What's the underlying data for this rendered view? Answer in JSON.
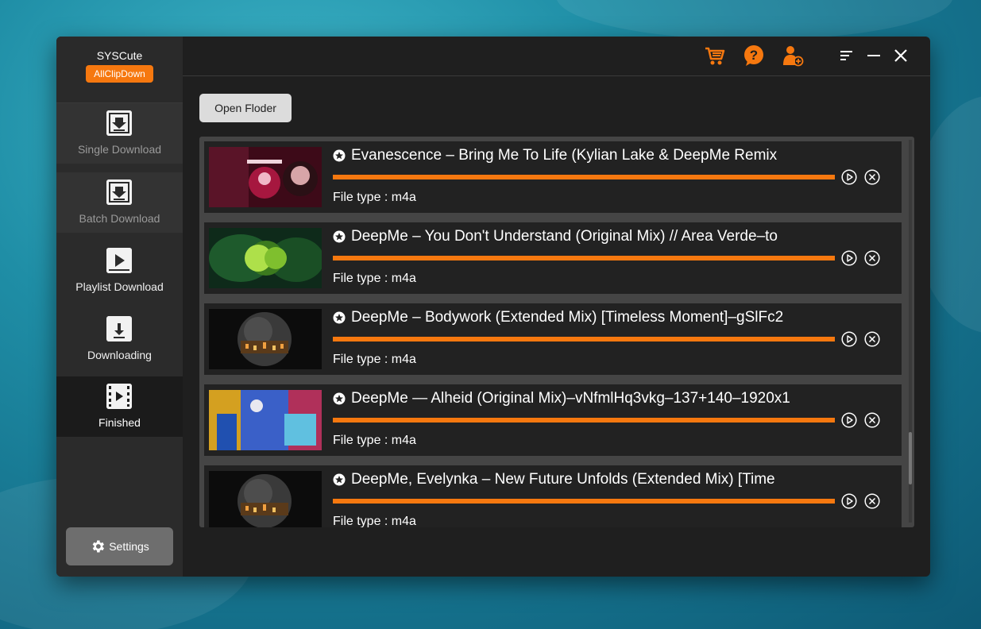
{
  "brand": {
    "name": "SYSCute",
    "badge": "AllClipDown"
  },
  "nav": [
    {
      "label": "Single Download",
      "icon": "download-box-icon"
    },
    {
      "label": "Batch Download",
      "icon": "download-box-icon"
    },
    {
      "label": "Playlist Download",
      "icon": "play-box-icon"
    },
    {
      "label": "Downloading",
      "icon": "file-download-icon"
    },
    {
      "label": "Finished",
      "icon": "film-icon"
    }
  ],
  "settings": {
    "label": "Settings"
  },
  "toolbar": {
    "open_folder": "Open Floder"
  },
  "colors": {
    "accent": "#f6780f",
    "window_bg": "#1f1f1f",
    "sidebar_bg": "#2b2b2b",
    "row_bg": "#222222"
  },
  "items": [
    {
      "title": "Evanescence – Bring Me To Life (Kylian Lake & DeepMe Remix",
      "file_type": "File type : m4a",
      "progress": 1.0
    },
    {
      "title": "DeepMe – You Don't Understand (Original Mix) // Area Verde–to",
      "file_type": "File type : m4a",
      "progress": 1.0
    },
    {
      "title": "DeepMe – Bodywork (Extended Mix) [Timeless Moment]–gSlFc2",
      "file_type": "File type : m4a",
      "progress": 1.0
    },
    {
      "title": "DeepMe — Alheid (Original Mix)–vNfmlHq3vkg–137+140–1920x1",
      "file_type": "File type : m4a",
      "progress": 1.0
    },
    {
      "title": "DeepMe, Evelynka  – New Future Unfolds (Extended Mix) [Time",
      "file_type": "File type : m4a",
      "progress": 1.0
    }
  ]
}
